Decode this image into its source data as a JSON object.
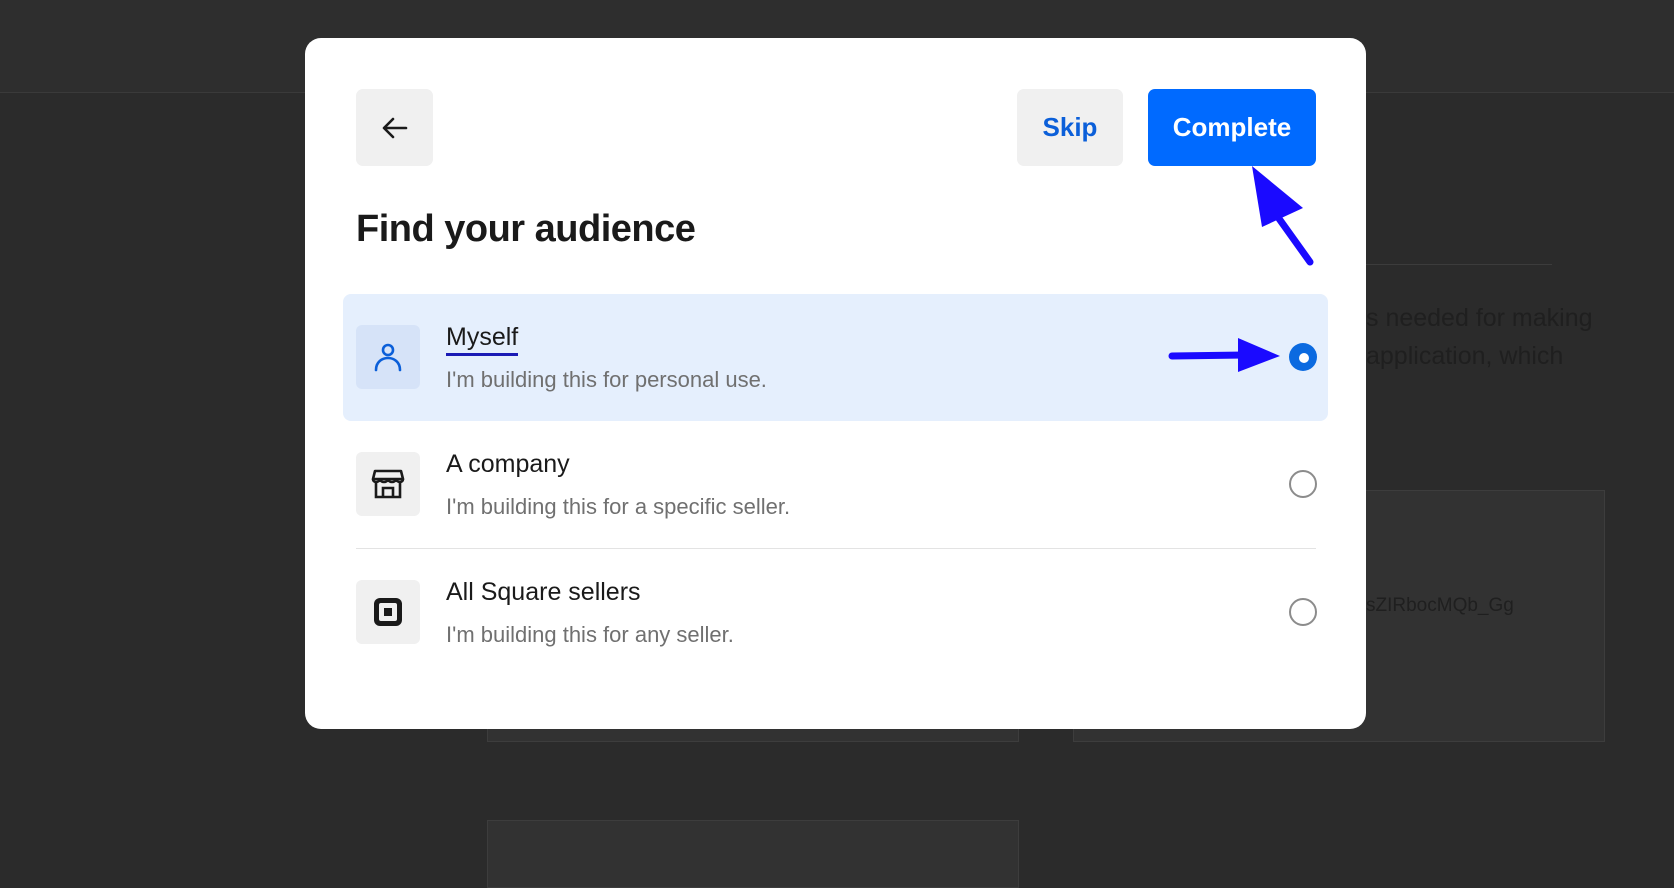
{
  "background": {
    "text_line_1": "s needed for making",
    "text_line_2": "application, which",
    "key_fragment": "sZIRbocMQb_Gg"
  },
  "modal": {
    "back_icon": "arrow-left-icon",
    "skip_label": "Skip",
    "complete_label": "Complete",
    "title": "Find your audience",
    "options": [
      {
        "label": "Myself",
        "description": "I'm building this for personal use.",
        "icon": "person-icon",
        "selected": true
      },
      {
        "label": "A company",
        "description": "I'm building this for a specific seller.",
        "icon": "storefront-icon",
        "selected": false
      },
      {
        "label": "All Square sellers",
        "description": "I'm building this for any seller.",
        "icon": "square-logo-icon",
        "selected": false
      }
    ]
  },
  "colors": {
    "accent": "#006aff",
    "selected_bg": "#e5effd",
    "annotation_arrow": "#1a0aff"
  }
}
